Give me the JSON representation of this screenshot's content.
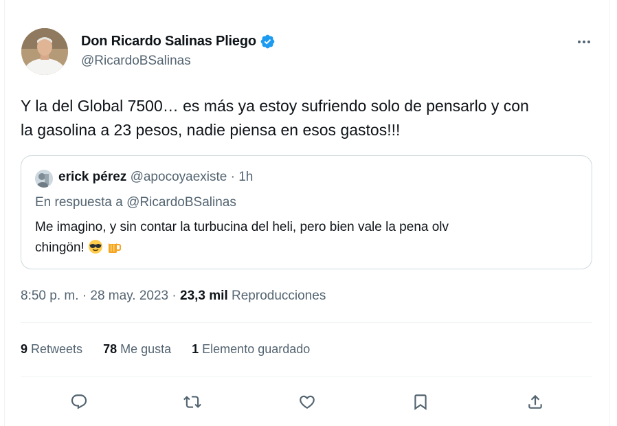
{
  "author": {
    "display_name": "Don Ricardo Salinas Pliego",
    "handle": "@RicardoBSalinas",
    "verified_icon": "verified-badge-icon"
  },
  "tweet": {
    "text_line1": "Y la del Global 7500… es más ya estoy sufriendo solo de pensarlo y con",
    "text_line2": "la gasolina a 23 pesos, nadie piensa en esos gastos!!!"
  },
  "quoted_tweet": {
    "name": "erick pérez",
    "handle": "@apocoyaexiste",
    "separator": " · ",
    "time": "1h",
    "reply_prefix": "En respuesta a ",
    "reply_to": "@RicardoBSalinas",
    "text_line1": "Me imagino, y sin contar la turbucina del heli, pero bien vale la pena olv",
    "text_line2": "chingön! ",
    "emojis": [
      "sunglasses-emoji",
      "beer-mug-emoji"
    ]
  },
  "meta": {
    "time": "8:50 p. m.",
    "separator": " · ",
    "date": "28 may. 2023",
    "views_count": "23,3 mil",
    "views_label": "Reproducciones"
  },
  "stats": {
    "retweets_count": "9",
    "retweets_label": "Retweets",
    "likes_count": "78",
    "likes_label": "Me gusta",
    "bookmarks_count": "1",
    "bookmarks_label": "Elemento guardado"
  },
  "actions": [
    "reply-icon",
    "retweet-icon",
    "like-icon",
    "bookmark-icon",
    "share-icon"
  ],
  "colors": {
    "text": "#0f1419",
    "secondary": "#536471",
    "verified": "#1d9bf0",
    "border": "#cfd9de",
    "divider": "#eff3f4"
  }
}
